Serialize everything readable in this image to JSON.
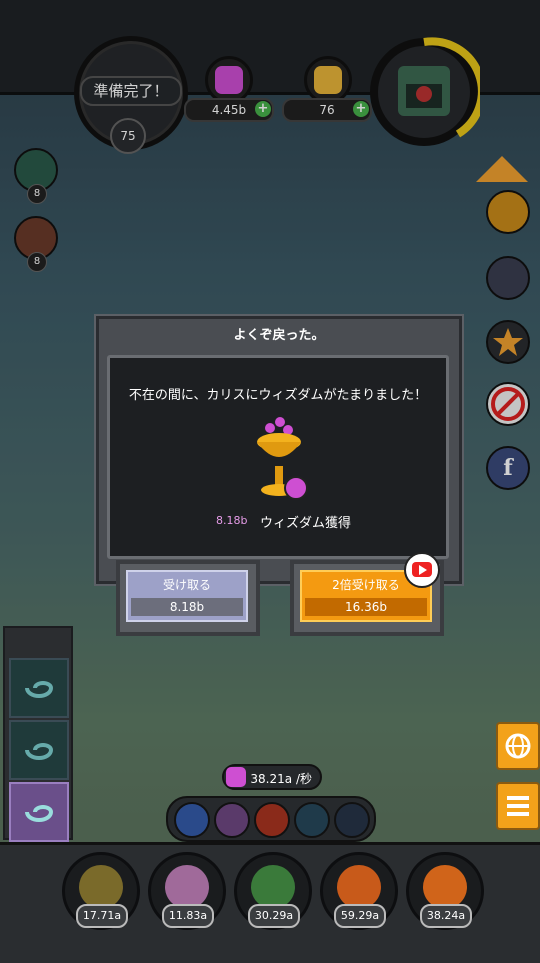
{
  "header": {
    "ready_label": "準備完了！",
    "level": "75",
    "gems_value": "4.45b",
    "coins_value": "76",
    "plus_symbol": "+"
  },
  "left_units": [
    {
      "count": "8"
    },
    {
      "count": "8"
    }
  ],
  "dialog": {
    "title": "よくぞ戻った。",
    "message": "不在の間に、カリスにウィズダムがたまりました！",
    "amount": "8.18b",
    "gain_label": "ウィズダム獲得",
    "claim_label": "受け取る",
    "claim_value": "8.18b",
    "double_label": "2倍受け取る",
    "double_value": "16.36b"
  },
  "rate": {
    "value": "38.21a",
    "unit": "/秒"
  },
  "heroes": [
    {
      "value": "17.71a"
    },
    {
      "value": "11.83a"
    },
    {
      "value": "30.29a"
    },
    {
      "value": "59.29a"
    },
    {
      "value": "38.24a"
    }
  ],
  "colors": {
    "accent_orange": "#f49a11",
    "wisdom_purple": "#ce4fd2",
    "plus_green": "#47b04b"
  }
}
